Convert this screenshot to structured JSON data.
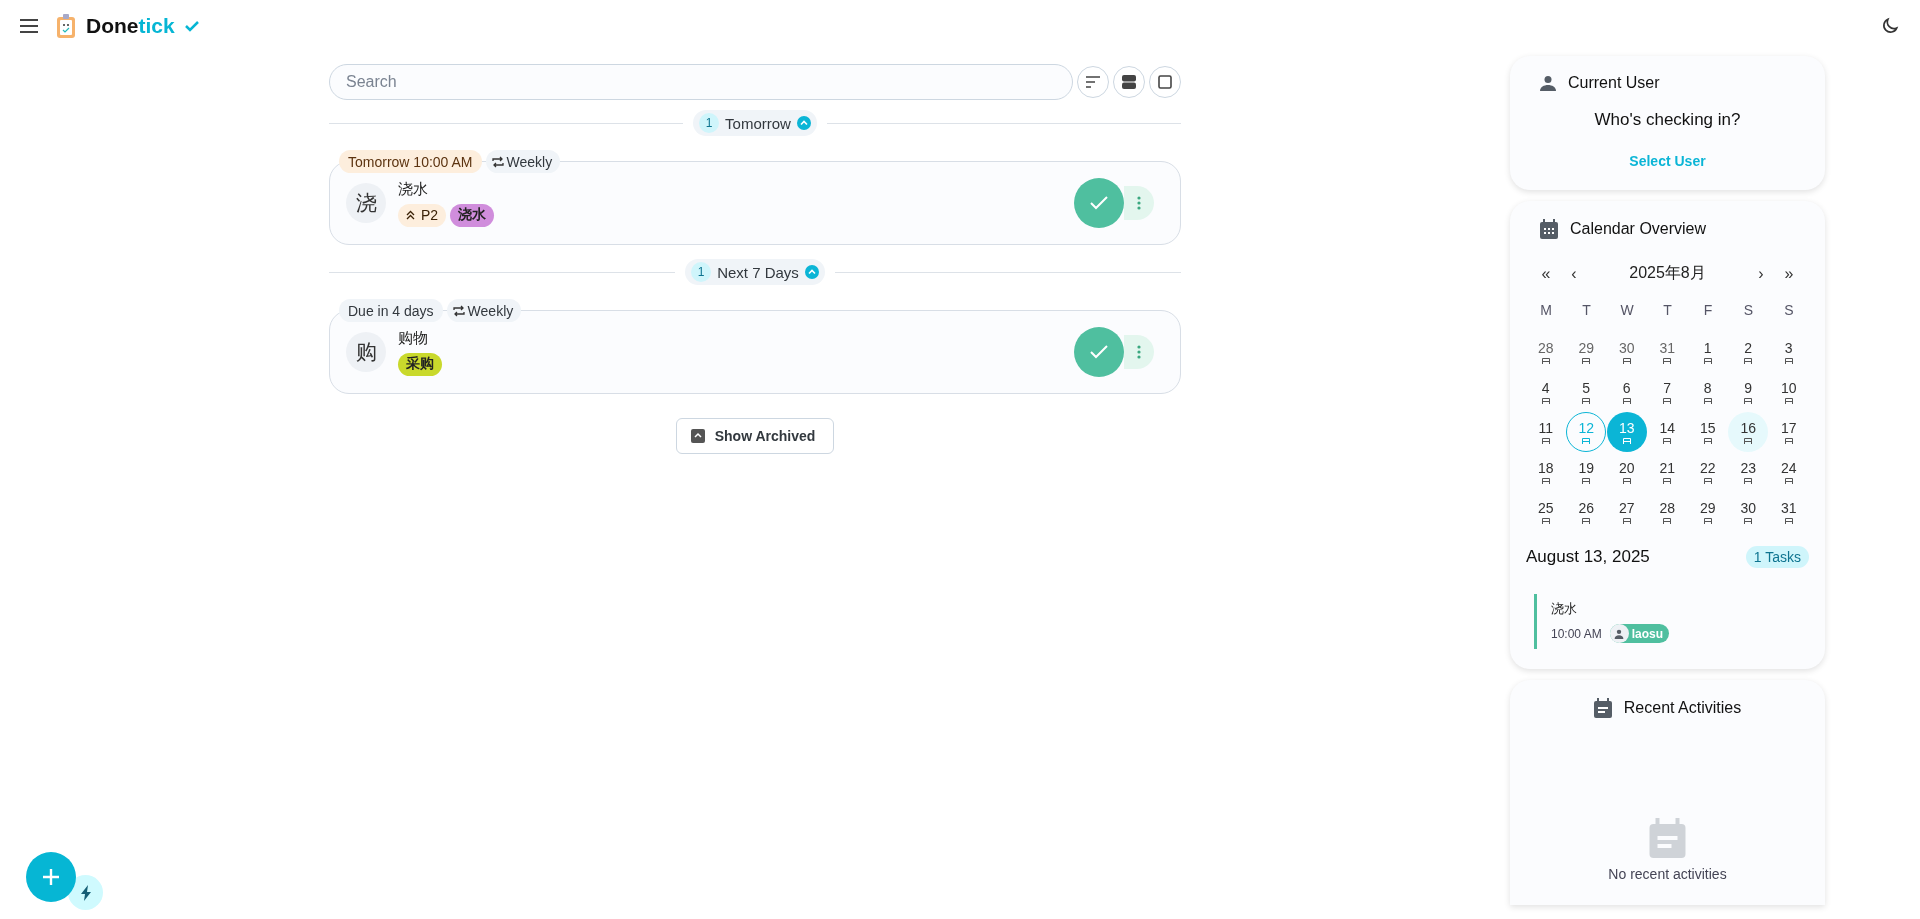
{
  "header": {
    "logo_main": "Done",
    "logo_accent": "tick"
  },
  "search": {
    "placeholder": "Search"
  },
  "sections": [
    {
      "count": "1",
      "title": "Tomorrow",
      "expanded": true,
      "tasks": [
        {
          "avatar": "浇",
          "name": "浇水",
          "due": "Tomorrow 10:00 AM",
          "urgent": true,
          "repeat": "Weekly",
          "priority": "P2",
          "labels": [
            {
              "text": "浇水",
              "color": "#d08ddc"
            }
          ]
        }
      ]
    },
    {
      "count": "1",
      "title": "Next 7 Days",
      "expanded": true,
      "tasks": [
        {
          "avatar": "购",
          "name": "购物",
          "due": "Due in 4 days",
          "urgent": false,
          "repeat": "Weekly",
          "labels": [
            {
              "text": "采购",
              "color": "#c9d92c"
            }
          ]
        }
      ]
    }
  ],
  "archive_button": "Show Archived",
  "current_user": {
    "title": "Current User",
    "prompt": "Who's checking in?",
    "action": "Select User"
  },
  "calendar": {
    "title": "Calendar Overview",
    "nav": [
      "«",
      "‹",
      "›",
      "»"
    ],
    "month": "2025年8月",
    "weekdays": [
      "M",
      "T",
      "W",
      "T",
      "F",
      "S",
      "S"
    ],
    "days": [
      {
        "label": "28",
        "outside": true,
        "today": false,
        "selected": false,
        "highlighted": false
      },
      {
        "label": "29",
        "outside": true,
        "today": false,
        "selected": false,
        "highlighted": false
      },
      {
        "label": "30",
        "outside": true,
        "today": false,
        "selected": false,
        "highlighted": false
      },
      {
        "label": "31",
        "outside": true,
        "today": false,
        "selected": false,
        "highlighted": false
      },
      {
        "label": "1",
        "outside": false,
        "today": false,
        "selected": false,
        "highlighted": false
      },
      {
        "label": "2",
        "outside": false,
        "today": false,
        "selected": false,
        "highlighted": false
      },
      {
        "label": "3",
        "outside": false,
        "today": false,
        "selected": false,
        "highlighted": false
      },
      {
        "label": "4",
        "outside": false,
        "today": false,
        "selected": false,
        "highlighted": false
      },
      {
        "label": "5",
        "outside": false,
        "today": false,
        "selected": false,
        "highlighted": false
      },
      {
        "label": "6",
        "outside": false,
        "today": false,
        "selected": false,
        "highlighted": false
      },
      {
        "label": "7",
        "outside": false,
        "today": false,
        "selected": false,
        "highlighted": false
      },
      {
        "label": "8",
        "outside": false,
        "today": false,
        "selected": false,
        "highlighted": false
      },
      {
        "label": "9",
        "outside": false,
        "today": false,
        "selected": false,
        "highlighted": false
      },
      {
        "label": "10",
        "outside": false,
        "today": false,
        "selected": false,
        "highlighted": false
      },
      {
        "label": "11",
        "outside": false,
        "today": false,
        "selected": false,
        "highlighted": false
      },
      {
        "label": "12",
        "outside": false,
        "today": true,
        "selected": false,
        "highlighted": false
      },
      {
        "label": "13",
        "outside": false,
        "today": false,
        "selected": true,
        "highlighted": false
      },
      {
        "label": "14",
        "outside": false,
        "today": false,
        "selected": false,
        "highlighted": false
      },
      {
        "label": "15",
        "outside": false,
        "today": false,
        "selected": false,
        "highlighted": false
      },
      {
        "label": "16",
        "outside": false,
        "today": false,
        "selected": false,
        "highlighted": true
      },
      {
        "label": "17",
        "outside": false,
        "today": false,
        "selected": false,
        "highlighted": false
      },
      {
        "label": "18",
        "outside": false,
        "today": false,
        "selected": false,
        "highlighted": false
      },
      {
        "label": "19",
        "outside": false,
        "today": false,
        "selected": false,
        "highlighted": false
      },
      {
        "label": "20",
        "outside": false,
        "today": false,
        "selected": false,
        "highlighted": false
      },
      {
        "label": "21",
        "outside": false,
        "today": false,
        "selected": false,
        "highlighted": false
      },
      {
        "label": "22",
        "outside": false,
        "today": false,
        "selected": false,
        "highlighted": false
      },
      {
        "label": "23",
        "outside": false,
        "today": false,
        "selected": false,
        "highlighted": false
      },
      {
        "label": "24",
        "outside": false,
        "today": false,
        "selected": false,
        "highlighted": false
      },
      {
        "label": "25",
        "outside": false,
        "today": false,
        "selected": false,
        "highlighted": false
      },
      {
        "label": "26",
        "outside": false,
        "today": false,
        "selected": false,
        "highlighted": false
      },
      {
        "label": "27",
        "outside": false,
        "today": false,
        "selected": false,
        "highlighted": false
      },
      {
        "label": "28",
        "outside": false,
        "today": false,
        "selected": false,
        "highlighted": false
      },
      {
        "label": "29",
        "outside": false,
        "today": false,
        "selected": false,
        "highlighted": false
      },
      {
        "label": "30",
        "outside": false,
        "today": false,
        "selected": false,
        "highlighted": false
      },
      {
        "label": "31",
        "outside": false,
        "today": false,
        "selected": false,
        "highlighted": false
      }
    ],
    "selected_date": "August 13, 2025",
    "task_count": "1 Tasks",
    "events": [
      {
        "name": "浇水",
        "time": "10:00 AM",
        "user": "laosu"
      }
    ]
  },
  "recent_activities": {
    "title": "Recent Activities",
    "empty_text": "No recent activities"
  }
}
